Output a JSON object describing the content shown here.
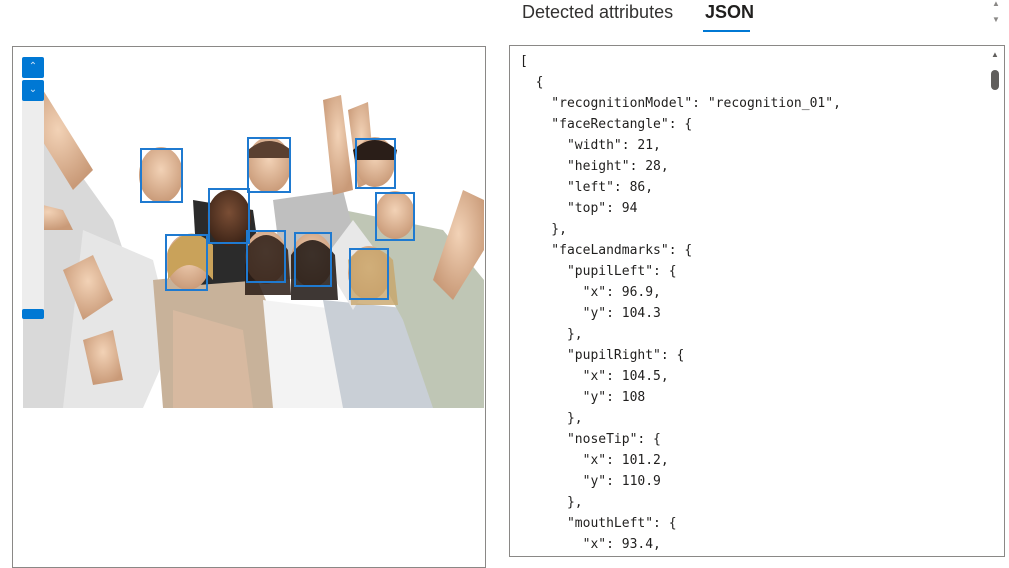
{
  "tabs": [
    {
      "label": "Detected attributes",
      "selected": false
    },
    {
      "label": "JSON",
      "selected": true
    }
  ],
  "colors": {
    "accent": "#0078d4",
    "face_box": "#1f7ad0"
  },
  "image_panel": {
    "zoom_in_icon": "chevron-up-icon",
    "zoom_out_icon": "chevron-down-icon",
    "zoom_in_glyph": "⌃",
    "zoom_out_glyph": "⌄",
    "zoom_level": 0.0,
    "faces_detected": 9
  },
  "json_view": {
    "text": "[\n  {\n    \"recognitionModel\": \"recognition_01\",\n    \"faceRectangle\": {\n      \"width\": 21,\n      \"height\": 28,\n      \"left\": 86,\n      \"top\": 94\n    },\n    \"faceLandmarks\": {\n      \"pupilLeft\": {\n        \"x\": 96.9,\n        \"y\": 104.3\n      },\n      \"pupilRight\": {\n        \"x\": 104.5,\n        \"y\": 108\n      },\n      \"noseTip\": {\n        \"x\": 101.2,\n        \"y\": 110.9\n      },\n      \"mouthLeft\": {\n        \"x\": 93.4,"
  }
}
